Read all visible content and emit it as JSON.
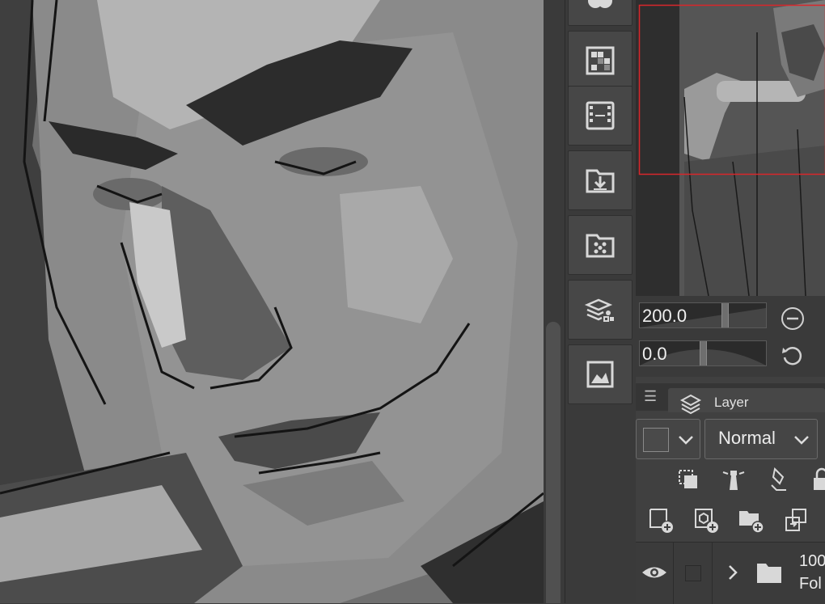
{
  "canvas": {
    "description_icon": "artwork-canvas"
  },
  "toolstrip": {
    "buttons": [
      {
        "icon": "color-circle-icon"
      },
      {
        "icon": "color-set-icon"
      },
      {
        "icon": "animation-timeline-icon"
      },
      {
        "icon": "import-material-icon"
      },
      {
        "icon": "material-folder-icon"
      },
      {
        "icon": "layer-property-icon"
      },
      {
        "icon": "image-preview-icon"
      }
    ]
  },
  "navigator": {
    "zoom_value": "200.0",
    "rotation_value": "0.0",
    "zoom_level": 0.67,
    "rotation_level": 0.5
  },
  "layer_panel": {
    "tab_label": "Layer",
    "blend_mode": "Normal",
    "layer_row": {
      "line1": "100",
      "line2": "Fol"
    }
  },
  "colors": {
    "accent_red": "#d9262b",
    "panel_bg": "#404040"
  }
}
